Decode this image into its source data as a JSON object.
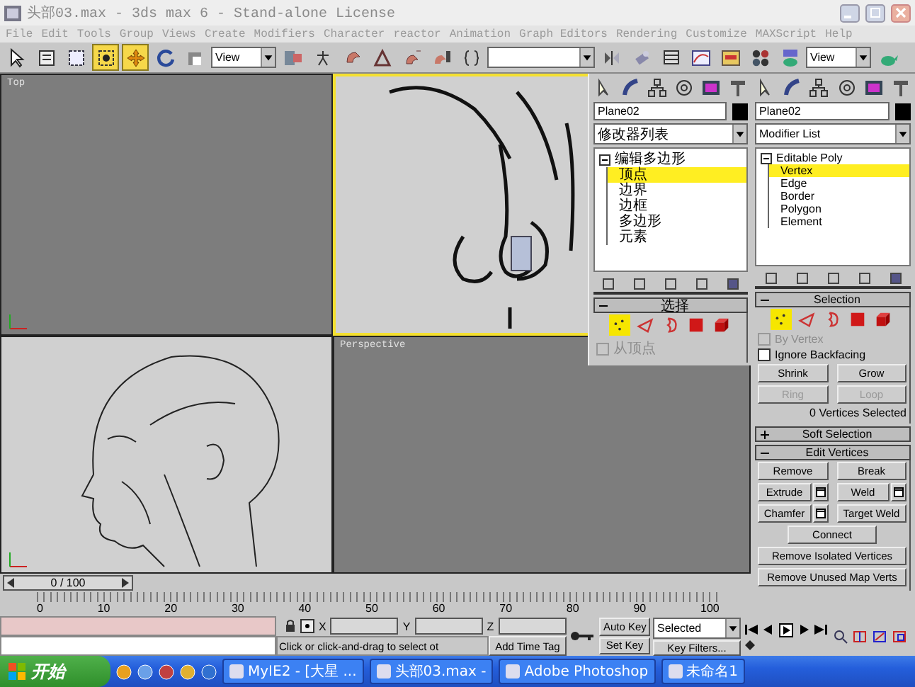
{
  "window": {
    "title": "头部03.max - 3ds max 6 - Stand-alone License"
  },
  "menu": [
    "File",
    "Edit",
    "Tools",
    "Group",
    "Views",
    "Create",
    "Modifiers",
    "Character",
    "reactor",
    "Animation",
    "Graph Editors",
    "Rendering",
    "Customize",
    "MAXScript",
    "Help"
  ],
  "toolbar": [
    {
      "kind": "select",
      "selected": false
    },
    {
      "kind": "select_by_name",
      "selected": false
    },
    {
      "kind": "region",
      "selected": false
    },
    {
      "kind": "crossing",
      "selected": true
    },
    {
      "kind": "move",
      "selected": true
    },
    {
      "kind": "rotate",
      "selected": false
    },
    {
      "kind": "scale",
      "selected": false
    },
    {
      "kind": "dropdown",
      "value": "View"
    },
    {
      "kind": "pivot",
      "selected": false
    },
    {
      "kind": "figure",
      "selected": false
    },
    {
      "kind": "snap",
      "selected": false
    },
    {
      "kind": "angle_snap",
      "selected": false
    },
    {
      "kind": "percent_snap",
      "selected": false
    },
    {
      "kind": "spinner_snap",
      "selected": false
    },
    {
      "kind": "text_edit",
      "selected": false
    },
    {
      "kind": "field"
    },
    {
      "kind": "mirror",
      "selected": false
    },
    {
      "kind": "align",
      "selected": false
    },
    {
      "kind": "layers",
      "selected": false
    },
    {
      "kind": "curve_editor",
      "selected": false
    },
    {
      "kind": "schematic",
      "selected": false
    },
    {
      "kind": "material",
      "selected": false
    },
    {
      "kind": "render",
      "selected": false
    },
    {
      "kind": "dropdown",
      "value": "View"
    },
    {
      "kind": "teapot",
      "selected": false
    }
  ],
  "viewports": [
    {
      "label": "Top",
      "kind": "empty",
      "active": false,
      "axis": true
    },
    {
      "kind": "front_sketch",
      "active": true,
      "axis": false
    },
    {
      "kind": "side_sketch",
      "active": false,
      "axis": true
    },
    {
      "label": "Perspective",
      "kind": "empty",
      "active": false,
      "axis": false
    }
  ],
  "panels": [
    {
      "object_name": "Plane02",
      "modifier_list": "修改器列表",
      "stack": {
        "label": "编辑多边形",
        "children": [
          {
            "label": "顶点",
            "selected": true
          },
          {
            "label": "边界",
            "selected": false
          },
          {
            "label": "边框",
            "selected": false
          },
          {
            "label": "多边形",
            "selected": false
          },
          {
            "label": "元素",
            "selected": false
          }
        ]
      },
      "rollouts": [
        {
          "title": "选择",
          "expanded": true,
          "modes": [
            {
              "kind": "vertex",
              "selected": true
            },
            {
              "kind": "edge",
              "selected": false
            },
            {
              "kind": "border",
              "selected": false
            },
            {
              "kind": "polygon",
              "selected": false
            },
            {
              "kind": "element",
              "selected": false
            }
          ],
          "checkboxes": [
            {
              "label": "从顶点",
              "checked": false,
              "disabled": true
            }
          ]
        }
      ]
    },
    {
      "object_name": "Plane02",
      "modifier_list": "Modifier List",
      "stack": {
        "label": "Editable Poly",
        "children": [
          {
            "label": "Vertex",
            "selected": true
          },
          {
            "label": "Edge",
            "selected": false
          },
          {
            "label": "Border",
            "selected": false
          },
          {
            "label": "Polygon",
            "selected": false
          },
          {
            "label": "Element",
            "selected": false
          }
        ]
      },
      "rollouts": [
        {
          "title": "Selection",
          "expanded": true,
          "modes": [
            {
              "kind": "vertex",
              "selected": true
            },
            {
              "kind": "edge",
              "selected": false
            },
            {
              "kind": "border",
              "selected": false
            },
            {
              "kind": "polygon",
              "selected": false
            },
            {
              "kind": "element",
              "selected": false
            }
          ],
          "checkboxes": [
            {
              "label": "By Vertex",
              "checked": false,
              "disabled": true
            },
            {
              "label": "Ignore Backfacing",
              "checked": false,
              "disabled": false
            }
          ],
          "button_rows": [
            [
              {
                "label": "Shrink",
                "disabled": false,
                "settings": false
              },
              {
                "label": "Grow",
                "disabled": false,
                "settings": false
              }
            ],
            [
              {
                "label": "Ring",
                "disabled": true,
                "settings": false
              },
              {
                "label": "Loop",
                "disabled": true,
                "settings": false
              }
            ]
          ],
          "status": "0 Vertices Selected"
        },
        {
          "title": "Soft Selection",
          "expanded": false
        },
        {
          "title": "Edit Vertices",
          "expanded": true,
          "button_rows": [
            [
              {
                "label": "Remove",
                "disabled": false,
                "settings": false
              },
              {
                "label": "Break",
                "disabled": false,
                "settings": false
              }
            ],
            [
              {
                "label": "Extrude",
                "disabled": false,
                "settings": true
              },
              {
                "label": "Weld",
                "disabled": false,
                "settings": true
              }
            ],
            [
              {
                "label": "Chamfer",
                "disabled": false,
                "settings": true
              },
              {
                "label": "Target Weld",
                "disabled": false,
                "settings": false
              }
            ],
            [
              {
                "label": "Connect",
                "disabled": false,
                "settings": false
              }
            ],
            [
              {
                "label": "Remove Isolated Vertices",
                "disabled": false,
                "settings": false
              }
            ],
            [
              {
                "label": "Remove Unused Map Verts",
                "disabled": false,
                "settings": false
              }
            ]
          ]
        }
      ]
    }
  ],
  "timeline": {
    "time_slider": {
      "label": "0 / 100",
      "level": 0
    },
    "ticks": [
      "0",
      "10",
      "20",
      "30",
      "40",
      "50",
      "60",
      "70",
      "80",
      "90",
      "100"
    ]
  },
  "status": {
    "coords": [
      "X",
      "Y",
      "Z"
    ],
    "prompt": "Click or click-and-drag to select ot",
    "time_tag": "Add Time Tag",
    "auto_key": "Auto Key",
    "set_key": "Set Key",
    "key_mode": "Selected",
    "key_filters": "Key Filters..."
  },
  "taskbar": {
    "start": "开始",
    "tasks": [
      "MyIE2 - [大星 ...",
      "头部03.max -",
      "Adobe Photoshop",
      "未命名1"
    ]
  }
}
